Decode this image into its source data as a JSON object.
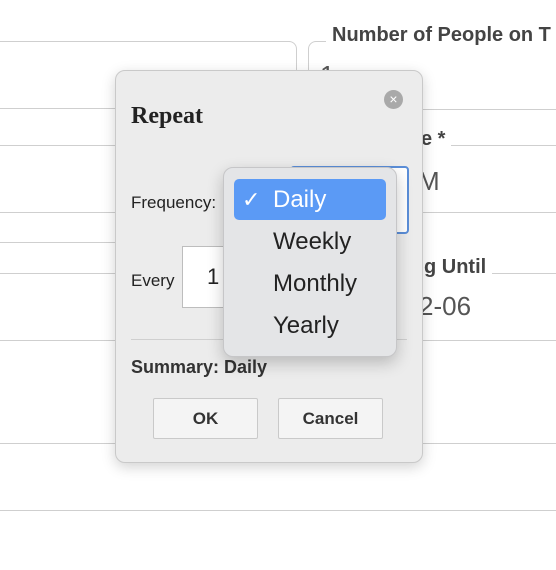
{
  "background": {
    "people_label": "Number of People on T",
    "people_value": "1",
    "time_label_partial": "e *",
    "time_value_partial": "M",
    "until_label_partial": "g Until",
    "until_value_partial": "2-06"
  },
  "dialog": {
    "title": "Repeat",
    "close_icon": "×",
    "frequency_label": "Frequency:",
    "every_label": "Every",
    "every_value": "1",
    "summary": "Summary: Daily",
    "ok_label": "OK",
    "cancel_label": "Cancel"
  },
  "dropdown": {
    "checkmark": "✓",
    "selected_index": 0,
    "options": [
      "Daily",
      "Weekly",
      "Monthly",
      "Yearly"
    ]
  }
}
